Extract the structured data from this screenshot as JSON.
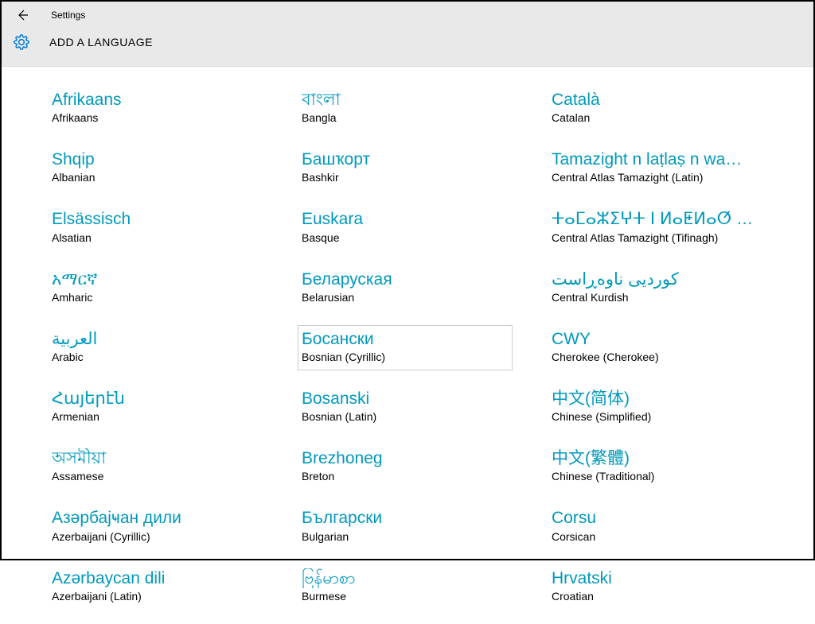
{
  "header": {
    "app_title": "Settings",
    "page_title": "ADD A LANGUAGE"
  },
  "columns": [
    [
      {
        "native": "Afrikaans",
        "english": "Afrikaans",
        "name": "afrikaans"
      },
      {
        "native": "Shqip",
        "english": "Albanian",
        "name": "albanian"
      },
      {
        "native": "Elsässisch",
        "english": "Alsatian",
        "name": "alsatian"
      },
      {
        "native": "አማርኛ",
        "english": "Amharic",
        "name": "amharic"
      },
      {
        "native": "العربية",
        "english": "Arabic",
        "name": "arabic"
      },
      {
        "native": "Հայերէն",
        "english": "Armenian",
        "name": "armenian"
      },
      {
        "native": "অসমীয়া",
        "english": "Assamese",
        "name": "assamese"
      },
      {
        "native": "Азәрбајҹан дили",
        "english": "Azerbaijani (Cyrillic)",
        "name": "azerbaijani-cyrillic"
      },
      {
        "native": "Azərbaycan dili",
        "english": "Azerbaijani (Latin)",
        "name": "azerbaijani-latin"
      }
    ],
    [
      {
        "native": "বাংলা",
        "english": "Bangla",
        "name": "bangla"
      },
      {
        "native": "Башҡорт",
        "english": "Bashkir",
        "name": "bashkir"
      },
      {
        "native": "Euskara",
        "english": "Basque",
        "name": "basque"
      },
      {
        "native": "Беларуская",
        "english": "Belarusian",
        "name": "belarusian"
      },
      {
        "native": "Босански",
        "english": "Bosnian (Cyrillic)",
        "name": "bosnian-cyrillic",
        "hover": true
      },
      {
        "native": "Bosanski",
        "english": "Bosnian (Latin)",
        "name": "bosnian-latin"
      },
      {
        "native": "Brezhoneg",
        "english": "Breton",
        "name": "breton"
      },
      {
        "native": "Български",
        "english": "Bulgarian",
        "name": "bulgarian"
      },
      {
        "native": "ဗြန်မာစာ",
        "english": "Burmese",
        "name": "burmese"
      }
    ],
    [
      {
        "native": "Català",
        "english": "Catalan",
        "name": "catalan"
      },
      {
        "native": "Tamazight n laṭlaṣ n wamm...",
        "english": "Central Atlas Tamazight (Latin)",
        "name": "tamazight-latin"
      },
      {
        "native": "ⵜⴰⵎⴰⵣⵉⵖⵜ ⵏ ⵍⴰⵟⵍⴰⵚ ⵏ ⵡⴰⵎⵎⴰⵙ",
        "english": "Central Atlas Tamazight (Tifinagh)",
        "name": "tamazight-tifinagh"
      },
      {
        "native": "کوردیی ناوەڕاست",
        "english": "Central Kurdish",
        "name": "central-kurdish"
      },
      {
        "native": "CWY",
        "english": "Cherokee (Cherokee)",
        "name": "cherokee"
      },
      {
        "native": "中文(简体)",
        "english": "Chinese (Simplified)",
        "name": "chinese-simplified"
      },
      {
        "native": "中文(繁體)",
        "english": "Chinese (Traditional)",
        "name": "chinese-traditional"
      },
      {
        "native": "Corsu",
        "english": "Corsican",
        "name": "corsican"
      },
      {
        "native": "Hrvatski",
        "english": "Croatian",
        "name": "croatian"
      }
    ]
  ]
}
